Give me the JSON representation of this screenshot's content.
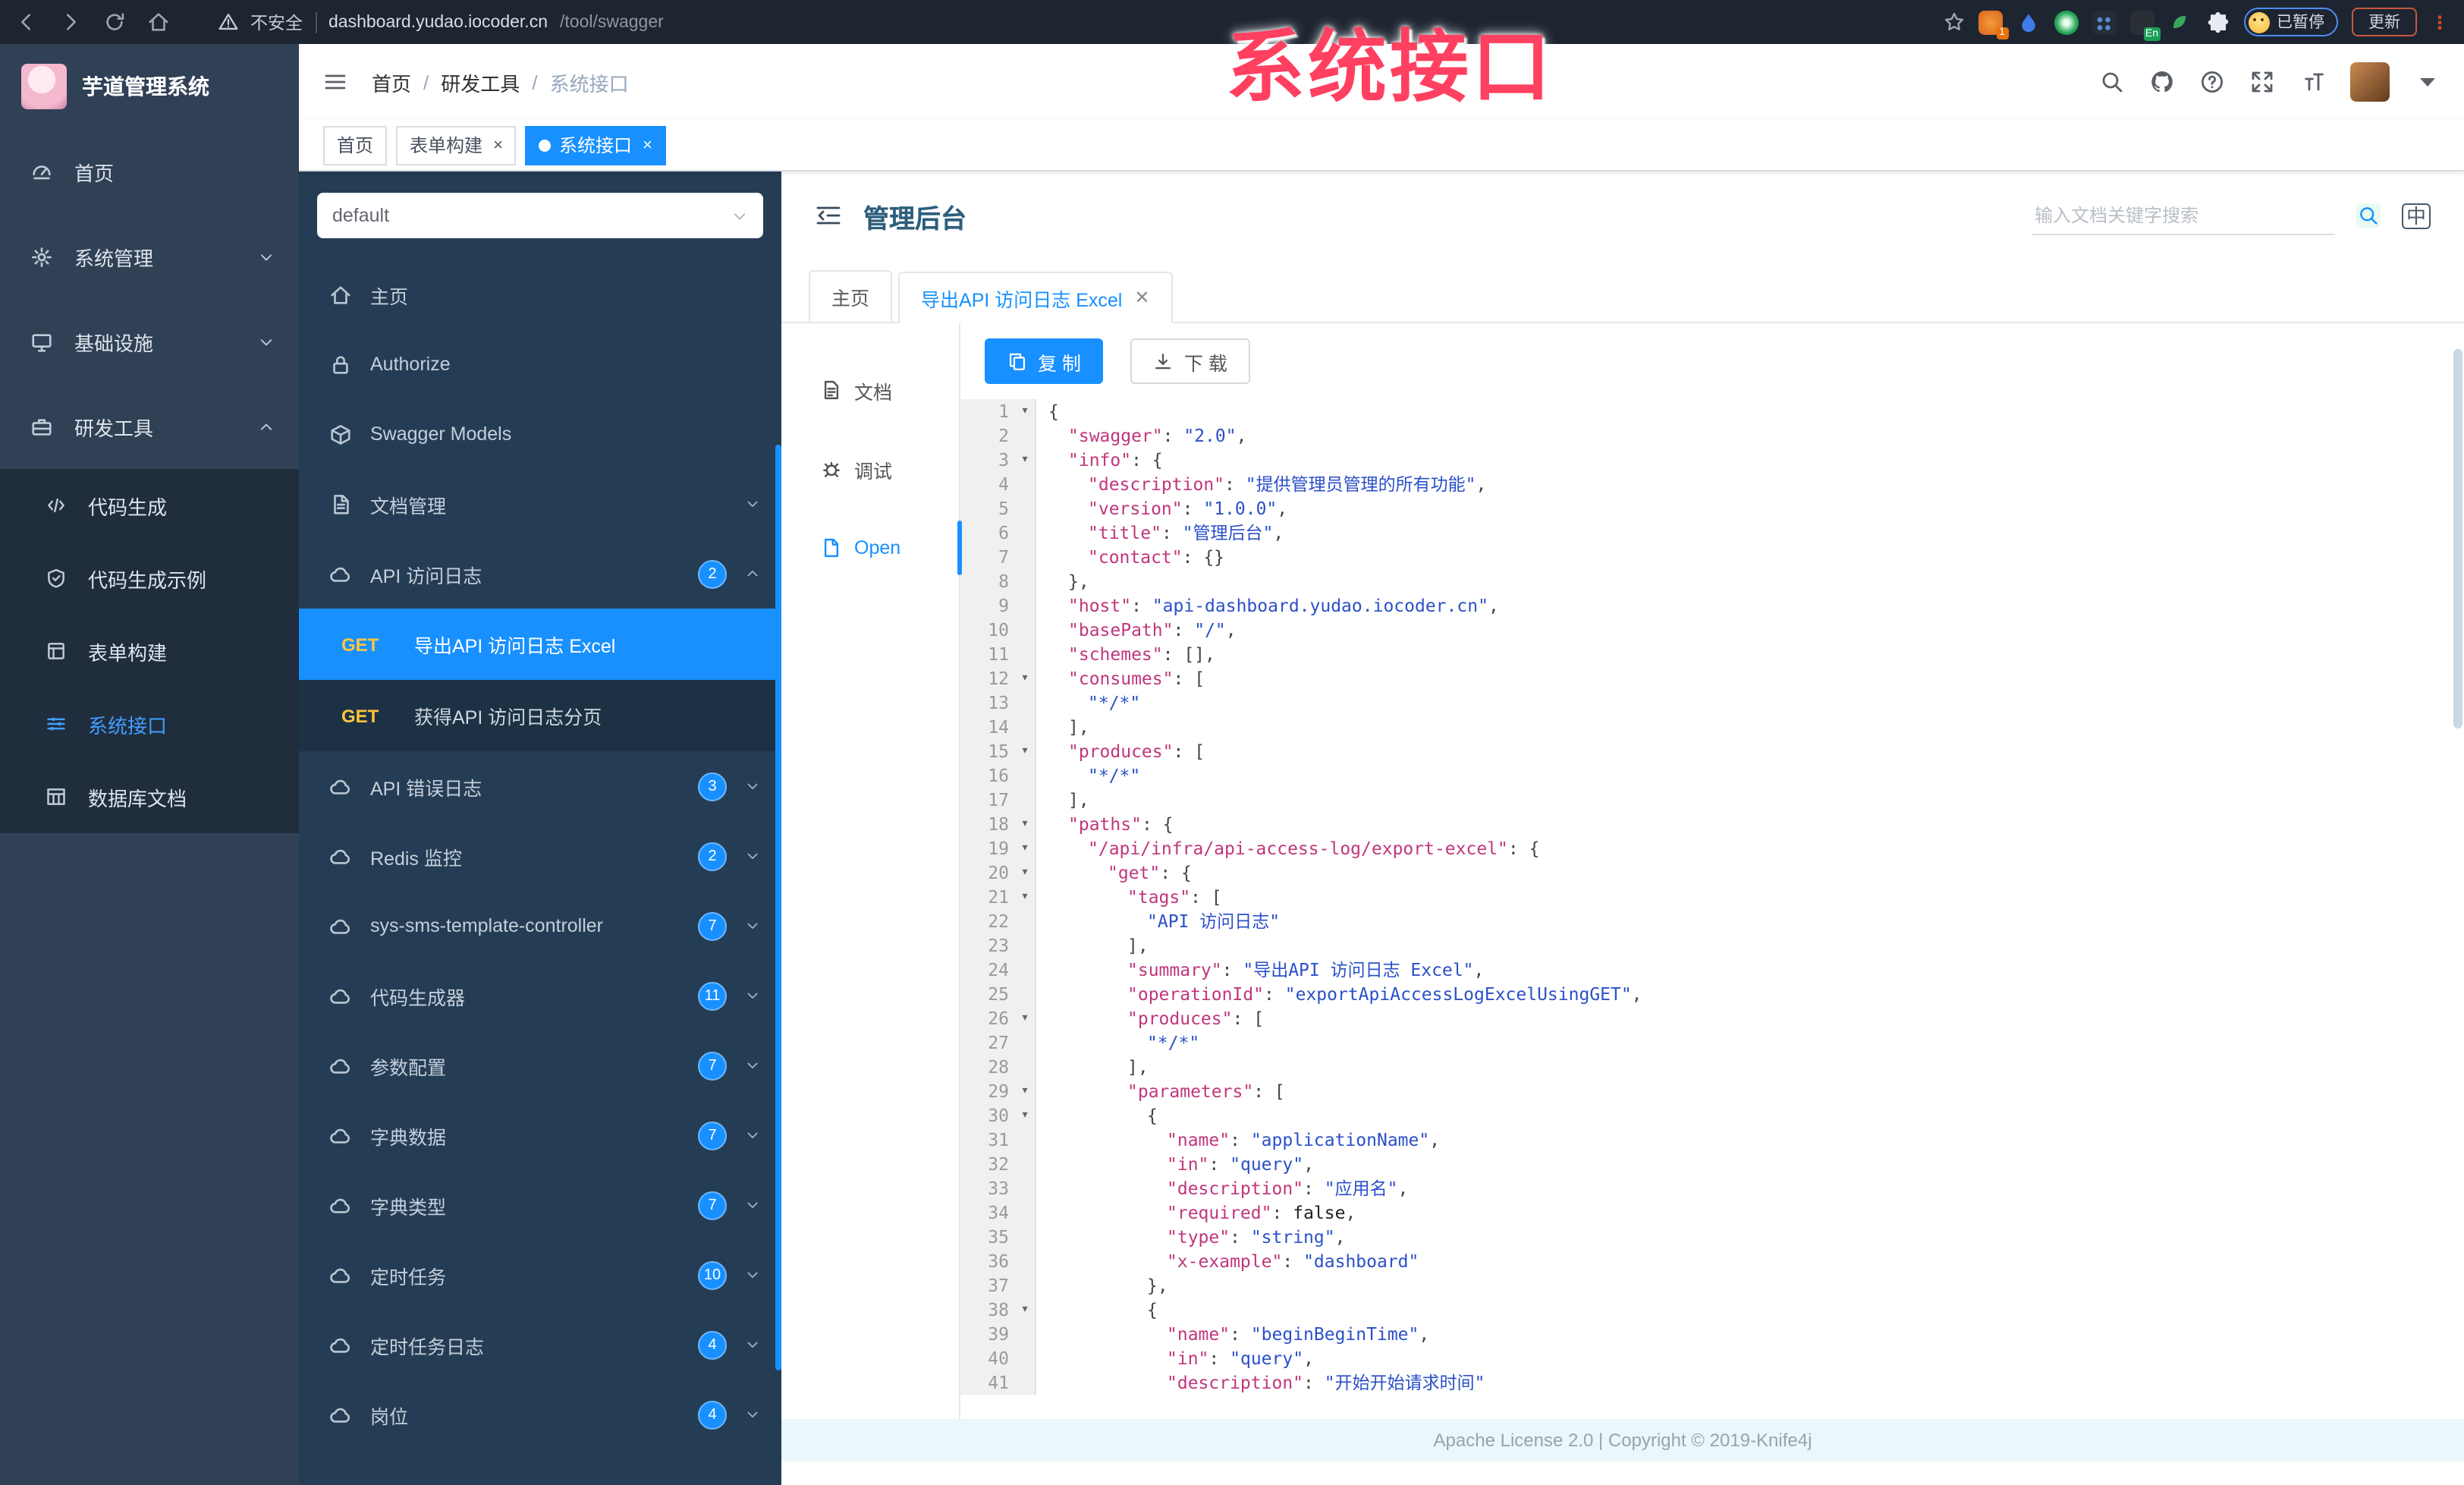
{
  "overlay": {
    "title": "系统接口"
  },
  "browser": {
    "security_label": "不安全",
    "url_host": "dashboard.yudao.iocoder.cn",
    "url_path": "/tool/swagger",
    "ext_badge": "1",
    "en_badge": "En",
    "paused_label": "已暂停",
    "update_label": "更新",
    "menu_glyph": "⋮"
  },
  "app": {
    "title": "芋道管理系统"
  },
  "header": {
    "breadcrumb": [
      "首页",
      "研发工具",
      "系统接口"
    ]
  },
  "tags": [
    {
      "label": "首页",
      "closable": false,
      "active": false
    },
    {
      "label": "表单构建",
      "closable": true,
      "active": false
    },
    {
      "label": "系统接口",
      "closable": true,
      "active": true
    }
  ],
  "sidebar": {
    "items": [
      {
        "label": "首页",
        "icon": "dashboard"
      },
      {
        "label": "系统管理",
        "icon": "gear",
        "chevron": "down"
      },
      {
        "label": "基础设施",
        "icon": "infra",
        "chevron": "down"
      },
      {
        "label": "研发工具",
        "icon": "tool",
        "chevron": "up",
        "children": [
          {
            "label": "代码生成",
            "icon": "code"
          },
          {
            "label": "代码生成示例",
            "icon": "shield"
          },
          {
            "label": "表单构建",
            "icon": "form"
          },
          {
            "label": "系统接口",
            "icon": "swagger",
            "active": true
          },
          {
            "label": "数据库文档",
            "icon": "table"
          }
        ]
      }
    ]
  },
  "api_panel": {
    "select_value": "default",
    "items": [
      {
        "label": "主页",
        "icon": "home"
      },
      {
        "label": "Authorize",
        "icon": "lock"
      },
      {
        "label": "Swagger Models",
        "icon": "models"
      },
      {
        "label": "文档管理",
        "icon": "docm",
        "chevron": "down"
      },
      {
        "label": "API 访问日志",
        "icon": "cloud",
        "badge": "2",
        "chevron": "up",
        "children": [
          {
            "method": "GET",
            "label": "导出API 访问日志 Excel",
            "active": true
          },
          {
            "method": "GET",
            "label": "获得API 访问日志分页",
            "active": false
          }
        ]
      },
      {
        "label": "API 错误日志",
        "icon": "cloud",
        "badge": "3",
        "chevron": "down"
      },
      {
        "label": "Redis 监控",
        "icon": "cloud",
        "badge": "2",
        "chevron": "down"
      },
      {
        "label": "sys-sms-template-controller",
        "icon": "cloud",
        "badge": "7",
        "chevron": "down"
      },
      {
        "label": "代码生成器",
        "icon": "cloud",
        "badge": "11",
        "chevron": "down"
      },
      {
        "label": "参数配置",
        "icon": "cloud",
        "badge": "7",
        "chevron": "down"
      },
      {
        "label": "字典数据",
        "icon": "cloud",
        "badge": "7",
        "chevron": "down"
      },
      {
        "label": "字典类型",
        "icon": "cloud",
        "badge": "7",
        "chevron": "down"
      },
      {
        "label": "定时任务",
        "icon": "cloud",
        "badge": "10",
        "chevron": "down"
      },
      {
        "label": "定时任务日志",
        "icon": "cloud",
        "badge": "4",
        "chevron": "down"
      },
      {
        "label": "岗位",
        "icon": "cloud",
        "badge": "4",
        "chevron": "down"
      }
    ]
  },
  "doc": {
    "title": "管理后台",
    "search_placeholder": "输入文档关键字搜索",
    "lang_label": "中",
    "tabs": [
      {
        "label": "主页",
        "closable": false,
        "active": false
      },
      {
        "label": "导出API 访问日志 Excel",
        "closable": true,
        "active": true
      }
    ],
    "side_tabs": [
      {
        "label": "文档",
        "icon": "filetext",
        "active": false
      },
      {
        "label": "调试",
        "icon": "debug",
        "active": false
      },
      {
        "label": "Open",
        "icon": "file",
        "active": true
      }
    ],
    "copy_label": "复 制",
    "download_label": "下 载"
  },
  "code": {
    "lines": [
      {
        "n": 1,
        "fold": true,
        "i": 0,
        "t": [
          [
            "p",
            "{"
          ]
        ]
      },
      {
        "n": 2,
        "fold": false,
        "i": 1,
        "t": [
          [
            "k",
            "\"swagger\""
          ],
          [
            "p",
            ": "
          ],
          [
            "s",
            "\"2.0\""
          ],
          [
            "p",
            ","
          ]
        ]
      },
      {
        "n": 3,
        "fold": true,
        "i": 1,
        "t": [
          [
            "k",
            "\"info\""
          ],
          [
            "p",
            ": {"
          ]
        ]
      },
      {
        "n": 4,
        "fold": false,
        "i": 2,
        "t": [
          [
            "k",
            "\"description\""
          ],
          [
            "p",
            ": "
          ],
          [
            "s",
            "\"提供管理员管理的所有功能\""
          ],
          [
            "p",
            ","
          ]
        ]
      },
      {
        "n": 5,
        "fold": false,
        "i": 2,
        "t": [
          [
            "k",
            "\"version\""
          ],
          [
            "p",
            ": "
          ],
          [
            "s",
            "\"1.0.0\""
          ],
          [
            "p",
            ","
          ]
        ]
      },
      {
        "n": 6,
        "fold": false,
        "i": 2,
        "t": [
          [
            "k",
            "\"title\""
          ],
          [
            "p",
            ": "
          ],
          [
            "s",
            "\"管理后台\""
          ],
          [
            "p",
            ","
          ]
        ]
      },
      {
        "n": 7,
        "fold": false,
        "i": 2,
        "t": [
          [
            "k",
            "\"contact\""
          ],
          [
            "p",
            ": {}"
          ]
        ]
      },
      {
        "n": 8,
        "fold": false,
        "i": 1,
        "t": [
          [
            "p",
            "},"
          ]
        ]
      },
      {
        "n": 9,
        "fold": false,
        "i": 1,
        "t": [
          [
            "k",
            "\"host\""
          ],
          [
            "p",
            ": "
          ],
          [
            "s",
            "\"api-dashboard.yudao.iocoder.cn\""
          ],
          [
            "p",
            ","
          ]
        ]
      },
      {
        "n": 10,
        "fold": false,
        "i": 1,
        "t": [
          [
            "k",
            "\"basePath\""
          ],
          [
            "p",
            ": "
          ],
          [
            "s",
            "\"/\""
          ],
          [
            "p",
            ","
          ]
        ]
      },
      {
        "n": 11,
        "fold": false,
        "i": 1,
        "t": [
          [
            "k",
            "\"schemes\""
          ],
          [
            "p",
            ": [],"
          ]
        ]
      },
      {
        "n": 12,
        "fold": true,
        "i": 1,
        "t": [
          [
            "k",
            "\"consumes\""
          ],
          [
            "p",
            ": ["
          ]
        ]
      },
      {
        "n": 13,
        "fold": false,
        "i": 2,
        "t": [
          [
            "s",
            "\"*/*\""
          ]
        ]
      },
      {
        "n": 14,
        "fold": false,
        "i": 1,
        "t": [
          [
            "p",
            "],"
          ]
        ]
      },
      {
        "n": 15,
        "fold": true,
        "i": 1,
        "t": [
          [
            "k",
            "\"produces\""
          ],
          [
            "p",
            ": ["
          ]
        ]
      },
      {
        "n": 16,
        "fold": false,
        "i": 2,
        "t": [
          [
            "s",
            "\"*/*\""
          ]
        ]
      },
      {
        "n": 17,
        "fold": false,
        "i": 1,
        "t": [
          [
            "p",
            "],"
          ]
        ]
      },
      {
        "n": 18,
        "fold": true,
        "i": 1,
        "t": [
          [
            "k",
            "\"paths\""
          ],
          [
            "p",
            ": {"
          ]
        ]
      },
      {
        "n": 19,
        "fold": true,
        "i": 2,
        "t": [
          [
            "k",
            "\"/api/infra/api-access-log/export-excel\""
          ],
          [
            "p",
            ": {"
          ]
        ]
      },
      {
        "n": 20,
        "fold": true,
        "i": 3,
        "t": [
          [
            "k",
            "\"get\""
          ],
          [
            "p",
            ": {"
          ]
        ]
      },
      {
        "n": 21,
        "fold": true,
        "i": 4,
        "t": [
          [
            "k",
            "\"tags\""
          ],
          [
            "p",
            ": ["
          ]
        ]
      },
      {
        "n": 22,
        "fold": false,
        "i": 5,
        "t": [
          [
            "s",
            "\"API 访问日志\""
          ]
        ]
      },
      {
        "n": 23,
        "fold": false,
        "i": 4,
        "t": [
          [
            "p",
            "],"
          ]
        ]
      },
      {
        "n": 24,
        "fold": false,
        "i": 4,
        "t": [
          [
            "k",
            "\"summary\""
          ],
          [
            "p",
            ": "
          ],
          [
            "s",
            "\"导出API 访问日志 Excel\""
          ],
          [
            "p",
            ","
          ]
        ]
      },
      {
        "n": 25,
        "fold": false,
        "i": 4,
        "t": [
          [
            "k",
            "\"operationId\""
          ],
          [
            "p",
            ": "
          ],
          [
            "s",
            "\"exportApiAccessLogExcelUsingGET\""
          ],
          [
            "p",
            ","
          ]
        ]
      },
      {
        "n": 26,
        "fold": true,
        "i": 4,
        "t": [
          [
            "k",
            "\"produces\""
          ],
          [
            "p",
            ": ["
          ]
        ]
      },
      {
        "n": 27,
        "fold": false,
        "i": 5,
        "t": [
          [
            "s",
            "\"*/*\""
          ]
        ]
      },
      {
        "n": 28,
        "fold": false,
        "i": 4,
        "t": [
          [
            "p",
            "],"
          ]
        ]
      },
      {
        "n": 29,
        "fold": true,
        "i": 4,
        "t": [
          [
            "k",
            "\"parameters\""
          ],
          [
            "p",
            ": ["
          ]
        ]
      },
      {
        "n": 30,
        "fold": true,
        "i": 5,
        "t": [
          [
            "p",
            "{"
          ]
        ]
      },
      {
        "n": 31,
        "fold": false,
        "i": 6,
        "t": [
          [
            "k",
            "\"name\""
          ],
          [
            "p",
            ": "
          ],
          [
            "s",
            "\"applicationName\""
          ],
          [
            "p",
            ","
          ]
        ]
      },
      {
        "n": 32,
        "fold": false,
        "i": 6,
        "t": [
          [
            "k",
            "\"in\""
          ],
          [
            "p",
            ": "
          ],
          [
            "s",
            "\"query\""
          ],
          [
            "p",
            ","
          ]
        ]
      },
      {
        "n": 33,
        "fold": false,
        "i": 6,
        "t": [
          [
            "k",
            "\"description\""
          ],
          [
            "p",
            ": "
          ],
          [
            "s",
            "\"应用名\""
          ],
          [
            "p",
            ","
          ]
        ]
      },
      {
        "n": 34,
        "fold": false,
        "i": 6,
        "t": [
          [
            "k",
            "\"required\""
          ],
          [
            "p",
            ": "
          ],
          [
            "b",
            "false"
          ],
          [
            "p",
            ","
          ]
        ]
      },
      {
        "n": 35,
        "fold": false,
        "i": 6,
        "t": [
          [
            "k",
            "\"type\""
          ],
          [
            "p",
            ": "
          ],
          [
            "s",
            "\"string\""
          ],
          [
            "p",
            ","
          ]
        ]
      },
      {
        "n": 36,
        "fold": false,
        "i": 6,
        "t": [
          [
            "k",
            "\"x-example\""
          ],
          [
            "p",
            ": "
          ],
          [
            "s",
            "\"dashboard\""
          ]
        ]
      },
      {
        "n": 37,
        "fold": false,
        "i": 5,
        "t": [
          [
            "p",
            "},"
          ]
        ]
      },
      {
        "n": 38,
        "fold": true,
        "i": 5,
        "t": [
          [
            "p",
            "{"
          ]
        ]
      },
      {
        "n": 39,
        "fold": false,
        "i": 6,
        "t": [
          [
            "k",
            "\"name\""
          ],
          [
            "p",
            ": "
          ],
          [
            "s",
            "\"beginBeginTime\""
          ],
          [
            "p",
            ","
          ]
        ]
      },
      {
        "n": 40,
        "fold": false,
        "i": 6,
        "t": [
          [
            "k",
            "\"in\""
          ],
          [
            "p",
            ": "
          ],
          [
            "s",
            "\"query\""
          ],
          [
            "p",
            ","
          ]
        ]
      },
      {
        "n": 41,
        "fold": false,
        "i": 6,
        "t": [
          [
            "k",
            "\"description\""
          ],
          [
            "p",
            ": "
          ],
          [
            "s",
            "\"开始开始请求时间\""
          ]
        ]
      }
    ]
  },
  "footer": {
    "text": "Apache License 2.0 | Copyright © 2019-Knife4j"
  }
}
